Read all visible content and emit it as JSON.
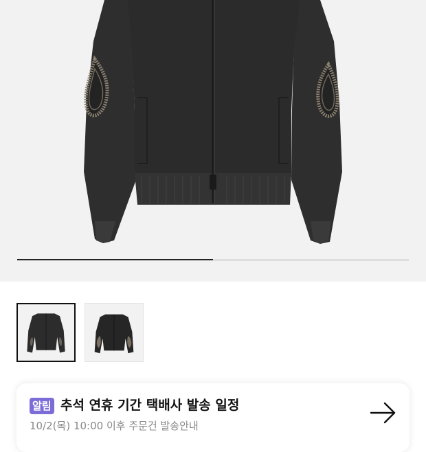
{
  "product_gallery": {
    "main_image": {
      "alt": "black knit zip-up jacket with paisley elbow patches"
    },
    "slider": {
      "current_index": 1,
      "total": 2
    },
    "thumbnails": [
      {
        "alt": "jacket thumbnail 1",
        "selected": true
      },
      {
        "alt": "jacket thumbnail 2",
        "selected": false
      }
    ]
  },
  "notice": {
    "badge": "알림",
    "title": "추석 연휴 기간 택배사 발송 일정",
    "subtitle": "10/2(목) 10:00 이후 주문건 발송안내",
    "badge_color": "#7b6cd8",
    "arrow_icon": "arrow-right-icon"
  }
}
